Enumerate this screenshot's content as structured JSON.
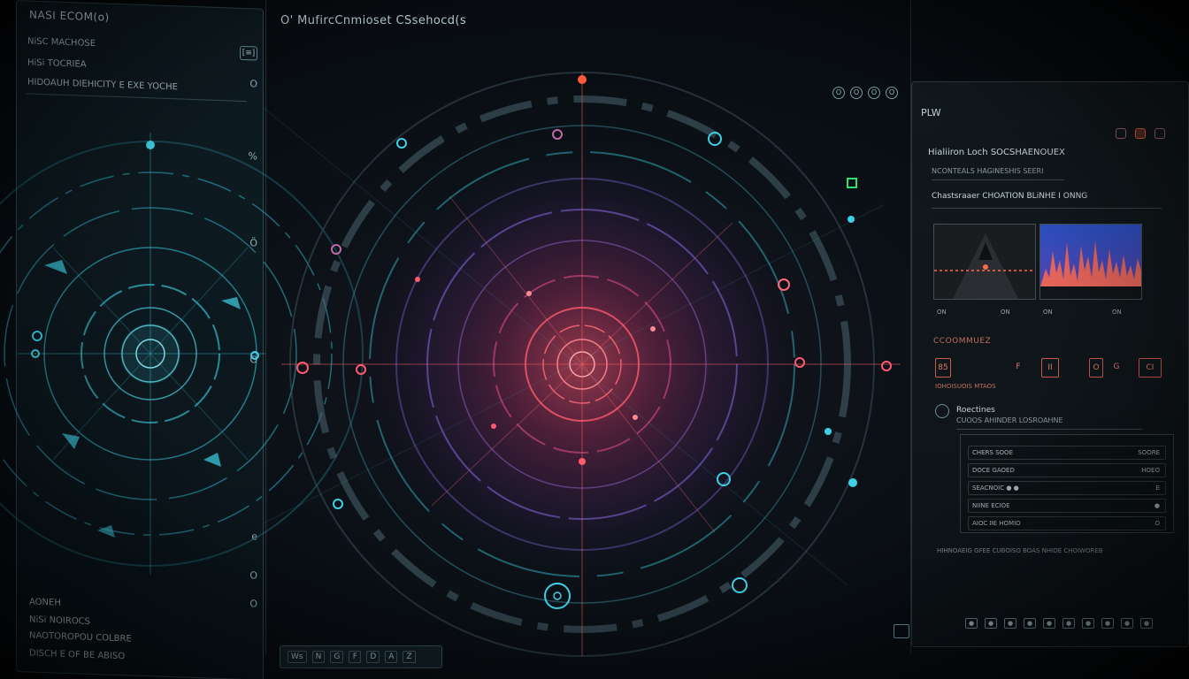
{
  "left_panel": {
    "title": "NASI ECOM(o)",
    "line1": "NiSC MACHOSE",
    "line2": "HiSi TOCRIEA",
    "line3": "HIDOAUH DIEHICITY E EXE YOCHE",
    "corner_btn": "[≡]",
    "side_marks": [
      "O",
      "%",
      "Ö",
      "O",
      "e",
      "O",
      "O"
    ],
    "footer": [
      "AONEH",
      "NiSi NOIROCS",
      "NAOTOROPOU COLBRE",
      "DISCH E OF BE ABISO"
    ]
  },
  "main_panel": {
    "title": "O' MufircCnmioset CSsehocd(s",
    "toolbar_icons": [
      "O",
      "O",
      "O",
      "O"
    ],
    "bottom_bar": [
      "Ws",
      "N",
      "G",
      "F",
      "D",
      "A",
      "Z"
    ]
  },
  "right_panel": {
    "header": "PLW",
    "heading": "Hialiiron Loch SOCSHAENOUEX",
    "sub_meta": "NCONTEALS HAGINESHIS SEERI",
    "section_title": "Chastsraaer CHOATION BLiNHE I ONNG",
    "thumb_captions": [
      "ON",
      "ON",
      "ON",
      "ON"
    ],
    "metrics_title": "CCOOMMUEZ",
    "metrics": [
      "85",
      "F",
      "II",
      "O",
      "G",
      "CI"
    ],
    "metric_label": "IOHOISUOIS MTAOS",
    "list_title": "Roectines",
    "list_sub": "CUOOS AHINDER LOSROAHNE",
    "rows": [
      {
        "left": "CHERS SOOE",
        "right": "SOORE"
      },
      {
        "left": "DOCE GAOED",
        "right": "HOEO"
      },
      {
        "left": "SEACNOIC ● ●",
        "right": "E"
      },
      {
        "left": "NIINE ECIOE",
        "right": "●"
      },
      {
        "left": "AIOC IIE HOMIO",
        "right": "O"
      }
    ],
    "footer_text": "HIHNOAEIG GFEE CUBOISO BOAS NHIOE CHOIWOREB",
    "toolbar": [
      "●",
      "●",
      "●",
      "●",
      "●",
      "●",
      "●",
      "●",
      "●",
      "●"
    ]
  },
  "colors": {
    "accent_cyan": "#3fd0e6",
    "accent_red": "#ff4a5a",
    "accent_violet": "#7a5cc4"
  }
}
